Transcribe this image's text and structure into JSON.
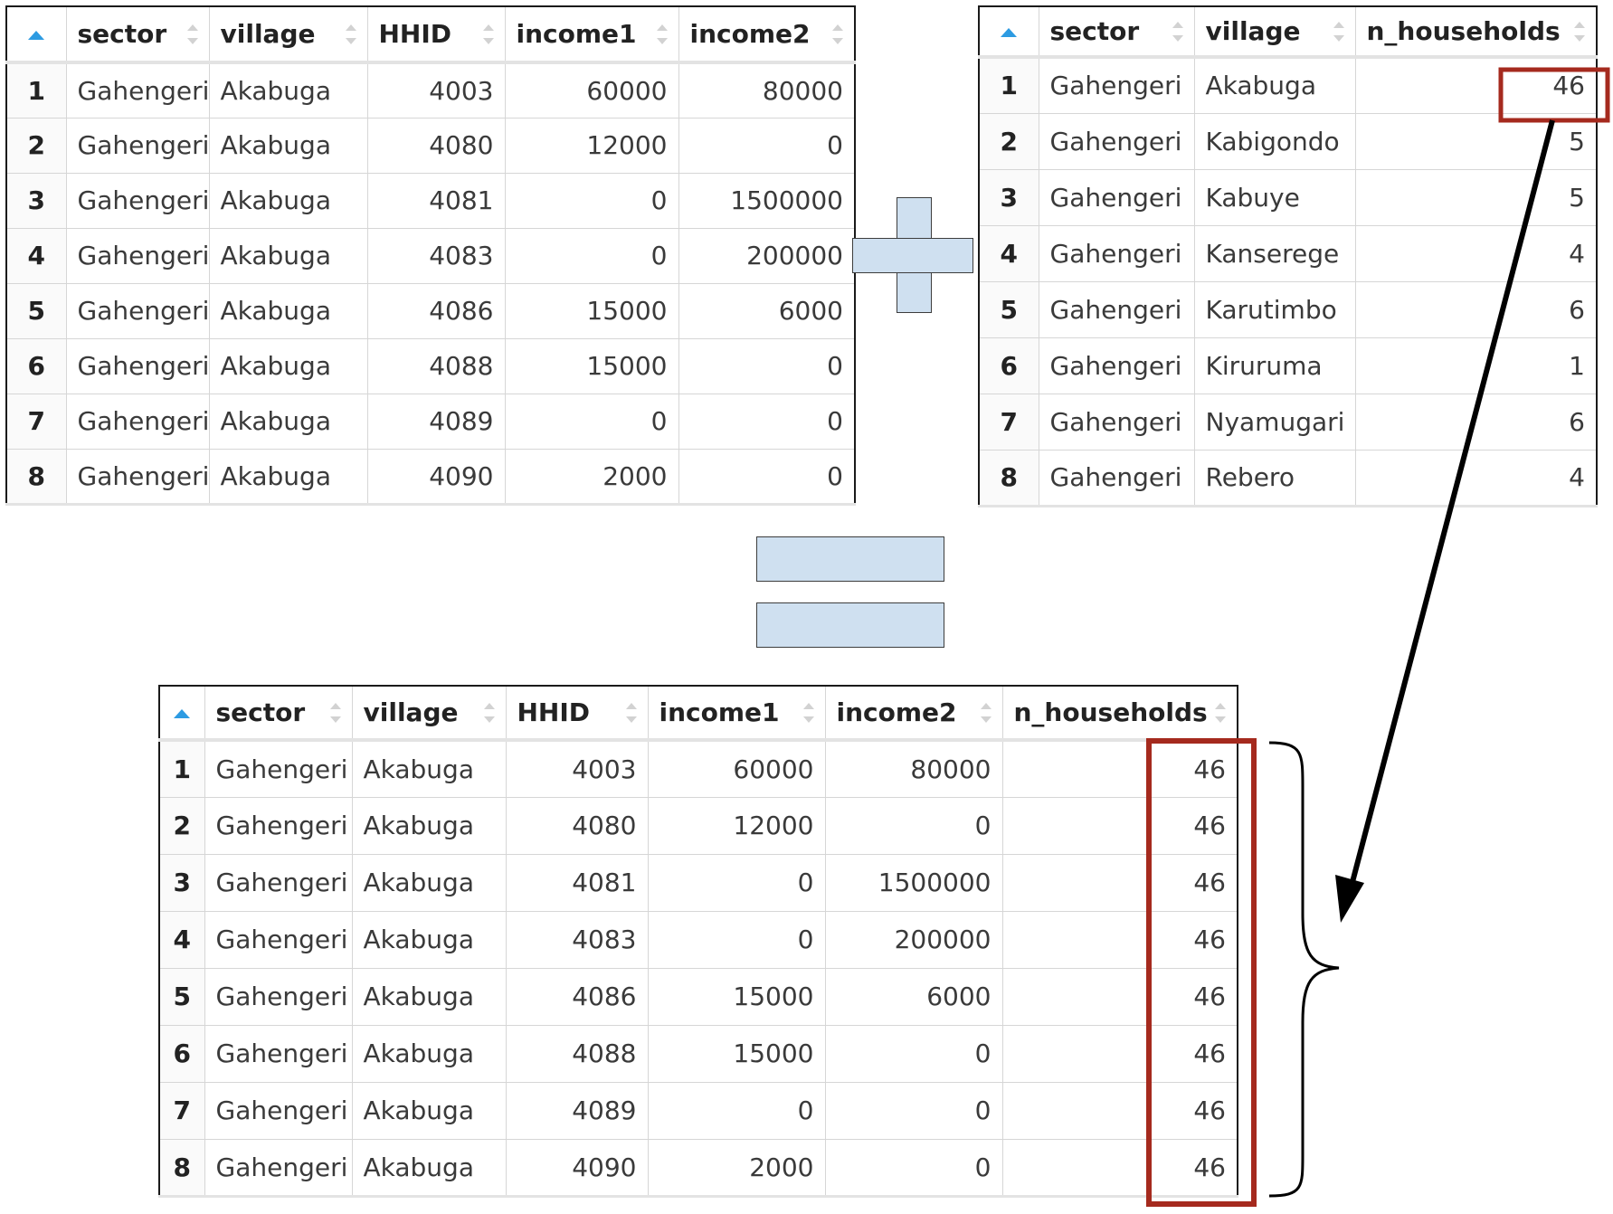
{
  "colors": {
    "highlight": "#a52a1e",
    "operator_fill": "#cfe0f0",
    "sort_accent": "#2d9be2"
  },
  "icons": {
    "sort": "sort-icon",
    "sort_asc": "sort-asc-icon"
  },
  "table_left": {
    "columns": [
      "sector",
      "village",
      "HHID",
      "income1",
      "income2"
    ],
    "rows": [
      [
        "1",
        "Gahengeri",
        "Akabuga",
        "4003",
        "60000",
        "80000"
      ],
      [
        "2",
        "Gahengeri",
        "Akabuga",
        "4080",
        "12000",
        "0"
      ],
      [
        "3",
        "Gahengeri",
        "Akabuga",
        "4081",
        "0",
        "1500000"
      ],
      [
        "4",
        "Gahengeri",
        "Akabuga",
        "4083",
        "0",
        "200000"
      ],
      [
        "5",
        "Gahengeri",
        "Akabuga",
        "4086",
        "15000",
        "6000"
      ],
      [
        "6",
        "Gahengeri",
        "Akabuga",
        "4088",
        "15000",
        "0"
      ],
      [
        "7",
        "Gahengeri",
        "Akabuga",
        "4089",
        "0",
        "0"
      ],
      [
        "8",
        "Gahengeri",
        "Akabuga",
        "4090",
        "2000",
        "0"
      ]
    ]
  },
  "table_right": {
    "columns": [
      "sector",
      "village",
      "n_households"
    ],
    "rows": [
      [
        "1",
        "Gahengeri",
        "Akabuga",
        "46"
      ],
      [
        "2",
        "Gahengeri",
        "Kabigondo",
        "5"
      ],
      [
        "3",
        "Gahengeri",
        "Kabuye",
        "5"
      ],
      [
        "4",
        "Gahengeri",
        "Kanserege",
        "4"
      ],
      [
        "5",
        "Gahengeri",
        "Karutimbo",
        "6"
      ],
      [
        "6",
        "Gahengeri",
        "Kiruruma",
        "1"
      ],
      [
        "7",
        "Gahengeri",
        "Nyamugari",
        "6"
      ],
      [
        "8",
        "Gahengeri",
        "Rebero",
        "4"
      ]
    ]
  },
  "table_result": {
    "columns": [
      "sector",
      "village",
      "HHID",
      "income1",
      "income2",
      "n_households"
    ],
    "rows": [
      [
        "1",
        "Gahengeri",
        "Akabuga",
        "4003",
        "60000",
        "80000",
        "46"
      ],
      [
        "2",
        "Gahengeri",
        "Akabuga",
        "4080",
        "12000",
        "0",
        "46"
      ],
      [
        "3",
        "Gahengeri",
        "Akabuga",
        "4081",
        "0",
        "1500000",
        "46"
      ],
      [
        "4",
        "Gahengeri",
        "Akabuga",
        "4083",
        "0",
        "200000",
        "46"
      ],
      [
        "5",
        "Gahengeri",
        "Akabuga",
        "4086",
        "15000",
        "6000",
        "46"
      ],
      [
        "6",
        "Gahengeri",
        "Akabuga",
        "4088",
        "15000",
        "0",
        "46"
      ],
      [
        "7",
        "Gahengeri",
        "Akabuga",
        "4089",
        "0",
        "0",
        "46"
      ],
      [
        "8",
        "Gahengeri",
        "Akabuga",
        "4090",
        "2000",
        "0",
        "46"
      ]
    ]
  }
}
